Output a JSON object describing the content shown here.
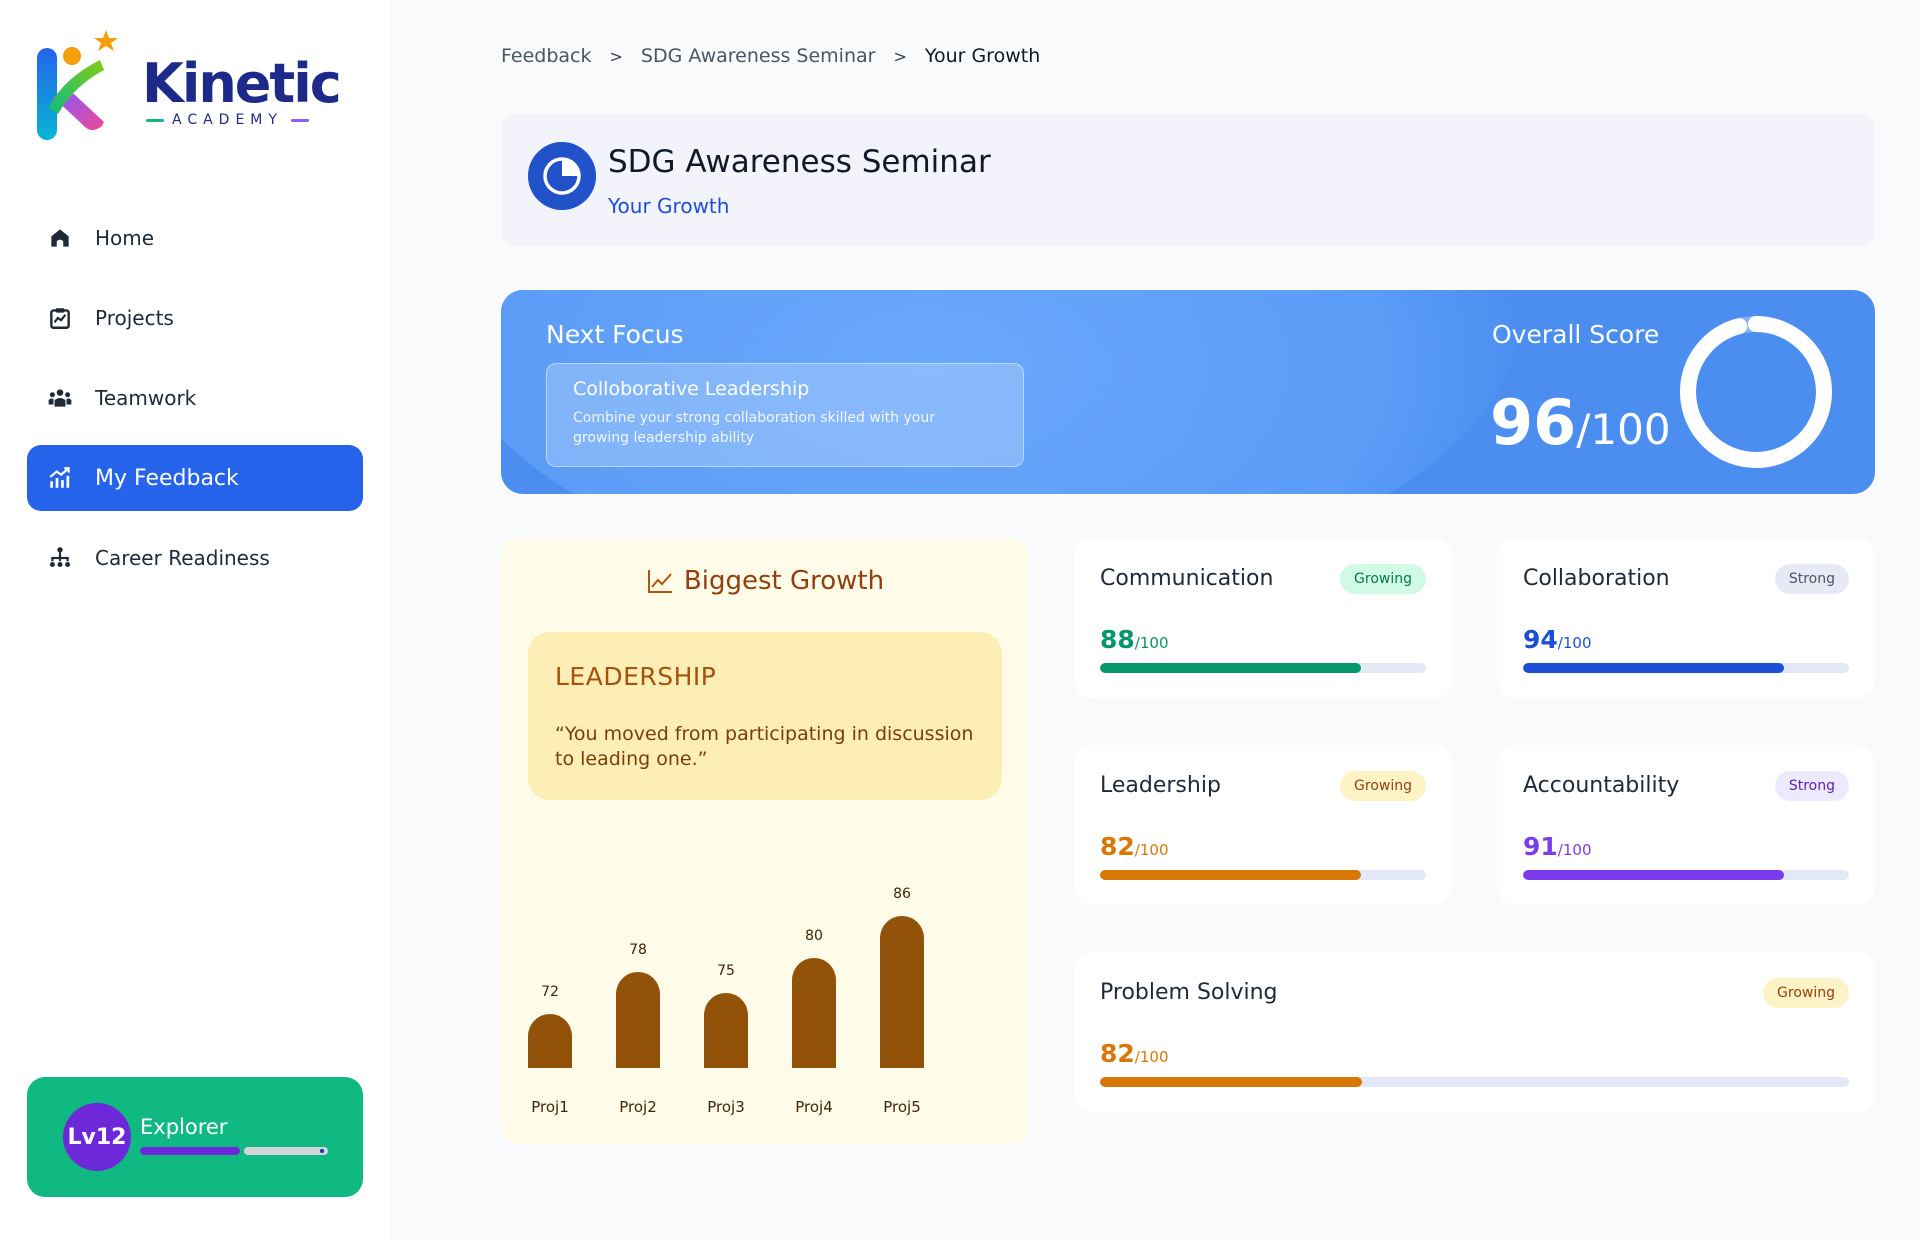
{
  "brand": {
    "name": "Kinetic",
    "tagline": "ACADEMY"
  },
  "sidebar": {
    "items": [
      {
        "label": "Home",
        "icon": "home-icon",
        "active": false
      },
      {
        "label": "Projects",
        "icon": "projects-icon",
        "active": false
      },
      {
        "label": "Teamwork",
        "icon": "team-icon",
        "active": false
      },
      {
        "label": "My Feedback",
        "icon": "chart-up-icon",
        "active": true
      },
      {
        "label": "Career Readiness",
        "icon": "hierarchy-icon",
        "active": false
      }
    ],
    "level": {
      "badge": "Lv12",
      "title": "Explorer",
      "progress": 0.53
    }
  },
  "breadcrumb": {
    "items": [
      "Feedback",
      "SDG Awareness Seminar",
      "Your Growth"
    ],
    "separator": ">"
  },
  "header": {
    "title": "SDG Awareness Seminar",
    "subtitle": "Your Growth"
  },
  "focus": {
    "label": "Next Focus",
    "title": "Colloborative Leadership",
    "description": "Combine your strong collaboration skilled with your growing leadership ability",
    "score_label": "Overall Score",
    "score": "96",
    "score_max": "/100",
    "score_fraction": 0.96
  },
  "growth": {
    "heading": "Biggest Growth",
    "quote_title": "LEADERSHIP",
    "quote": "“You moved from participating in discussion to leading one.”"
  },
  "chart_data": {
    "type": "bar",
    "categories": [
      "Proj1",
      "Proj2",
      "Proj3",
      "Proj4",
      "Proj5"
    ],
    "values": [
      72,
      78,
      75,
      80,
      86
    ],
    "title": "",
    "xlabel": "",
    "ylabel": "",
    "grid": false,
    "color": "#92520a"
  },
  "skills": [
    {
      "name": "Communication",
      "badge": "Growing",
      "score": "88",
      "max": "/100",
      "value": 0.8,
      "color": "#059669",
      "badge_bg": "#d1fae5",
      "badge_fg": "#047857"
    },
    {
      "name": "Collaboration",
      "badge": "Strong",
      "score": "94",
      "max": "/100",
      "value": 0.8,
      "color": "#1d4ed8",
      "badge_bg": "#e5eaf5",
      "badge_fg": "#4b5563"
    },
    {
      "name": "Leadership",
      "badge": "Growing",
      "score": "82",
      "max": "/100",
      "value": 0.8,
      "color": "#d97706",
      "badge_bg": "#fef3c7",
      "badge_fg": "#92400e"
    },
    {
      "name": "Accountability",
      "badge": "Strong",
      "score": "91",
      "max": "/100",
      "value": 0.8,
      "color": "#7c3aed",
      "badge_bg": "#ede9fe",
      "badge_fg": "#5b21b6"
    },
    {
      "name": "Problem Solving",
      "badge": "Growing",
      "score": "82",
      "max": "/100",
      "value": 0.35,
      "color": "#d97706",
      "badge_bg": "#fef3c7",
      "badge_fg": "#92400e"
    }
  ]
}
